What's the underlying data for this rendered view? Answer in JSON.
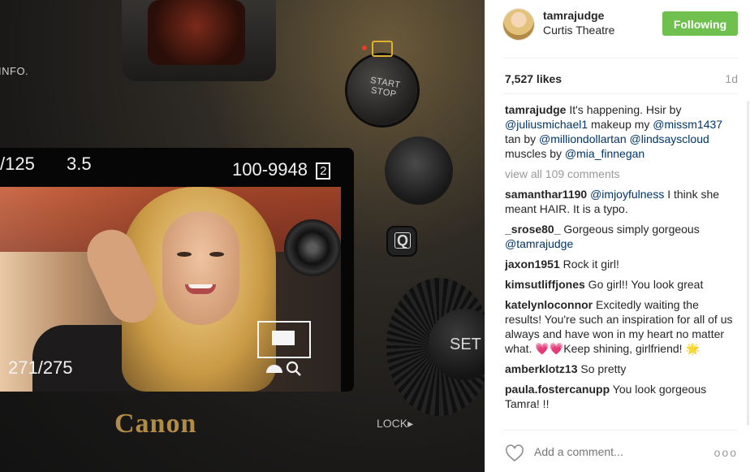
{
  "photo": {
    "camera_brand": "Canon",
    "lcd": {
      "shutter": "/125",
      "aperture": "3.5",
      "file_number": "100-9948",
      "card_slot": "2",
      "shots": "271/275"
    },
    "buttons": {
      "info": "INFO.",
      "start_stop": "START\nSTOP",
      "set": "SET",
      "q": "Q",
      "lock": "LOCK▸"
    }
  },
  "post": {
    "username": "tamrajudge",
    "location": "Curtis Theatre",
    "follow_label": "Following",
    "likes": "7,527 likes",
    "age": "1d",
    "caption": {
      "user": "tamrajudge",
      "parts": [
        {
          "text": " It's happening. Hsir by ",
          "type": "text"
        },
        {
          "text": "@juliusmichael1",
          "type": "mention"
        },
        {
          "text": " makeup my ",
          "type": "text"
        },
        {
          "text": "@missm1437",
          "type": "mention"
        },
        {
          "text": " tan by ",
          "type": "text"
        },
        {
          "text": "@milliondollartan",
          "type": "mention"
        },
        {
          "text": " ",
          "type": "text"
        },
        {
          "text": "@lindsayscloud",
          "type": "mention"
        },
        {
          "text": " muscles by ",
          "type": "text"
        },
        {
          "text": "@mia_finnegan",
          "type": "mention"
        }
      ]
    },
    "view_all": "view all 109 comments",
    "comments": [
      {
        "user": "samanthar1190",
        "parts": [
          {
            "text": " ",
            "type": "text"
          },
          {
            "text": "@imjoyfulness",
            "type": "mention"
          },
          {
            "text": " I think she meant HAIR. It is a typo.",
            "type": "text"
          }
        ]
      },
      {
        "user": "_srose80_",
        "parts": [
          {
            "text": " Gorgeous simply gorgeous ",
            "type": "text"
          },
          {
            "text": "@tamrajudge",
            "type": "mention"
          }
        ]
      },
      {
        "user": "jaxon1951",
        "parts": [
          {
            "text": " Rock it girl!",
            "type": "text"
          }
        ]
      },
      {
        "user": "kimsutliffjones",
        "parts": [
          {
            "text": " Go girl!! You look great",
            "type": "text"
          }
        ]
      },
      {
        "user": "katelynloconnor",
        "parts": [
          {
            "text": " Excitedly waiting the results! You're such an inspiration for all of us always and have won in my heart no matter what. ",
            "type": "text"
          },
          {
            "text": "💗💗",
            "type": "emoji-heart"
          },
          {
            "text": "Keep shining, girlfriend! ",
            "type": "text"
          },
          {
            "text": "🌟",
            "type": "emoji-star"
          }
        ]
      },
      {
        "user": "amberklotz13",
        "parts": [
          {
            "text": " So pretty",
            "type": "text"
          }
        ]
      },
      {
        "user": "paula.fostercanupp",
        "parts": [
          {
            "text": " You look gorgeous Tamra! !!",
            "type": "text"
          }
        ]
      }
    ],
    "add_comment_placeholder": "Add a comment...",
    "more_label": "ooo"
  },
  "colors": {
    "follow_green": "#70c050",
    "mention_blue": "#003569",
    "muted_gray": "#999999",
    "text_dark": "#262626"
  },
  "icons": [
    "heart-icon",
    "more-options-icon",
    "magnify-icon",
    "white-balance-icon",
    "camera-mode-icon"
  ]
}
